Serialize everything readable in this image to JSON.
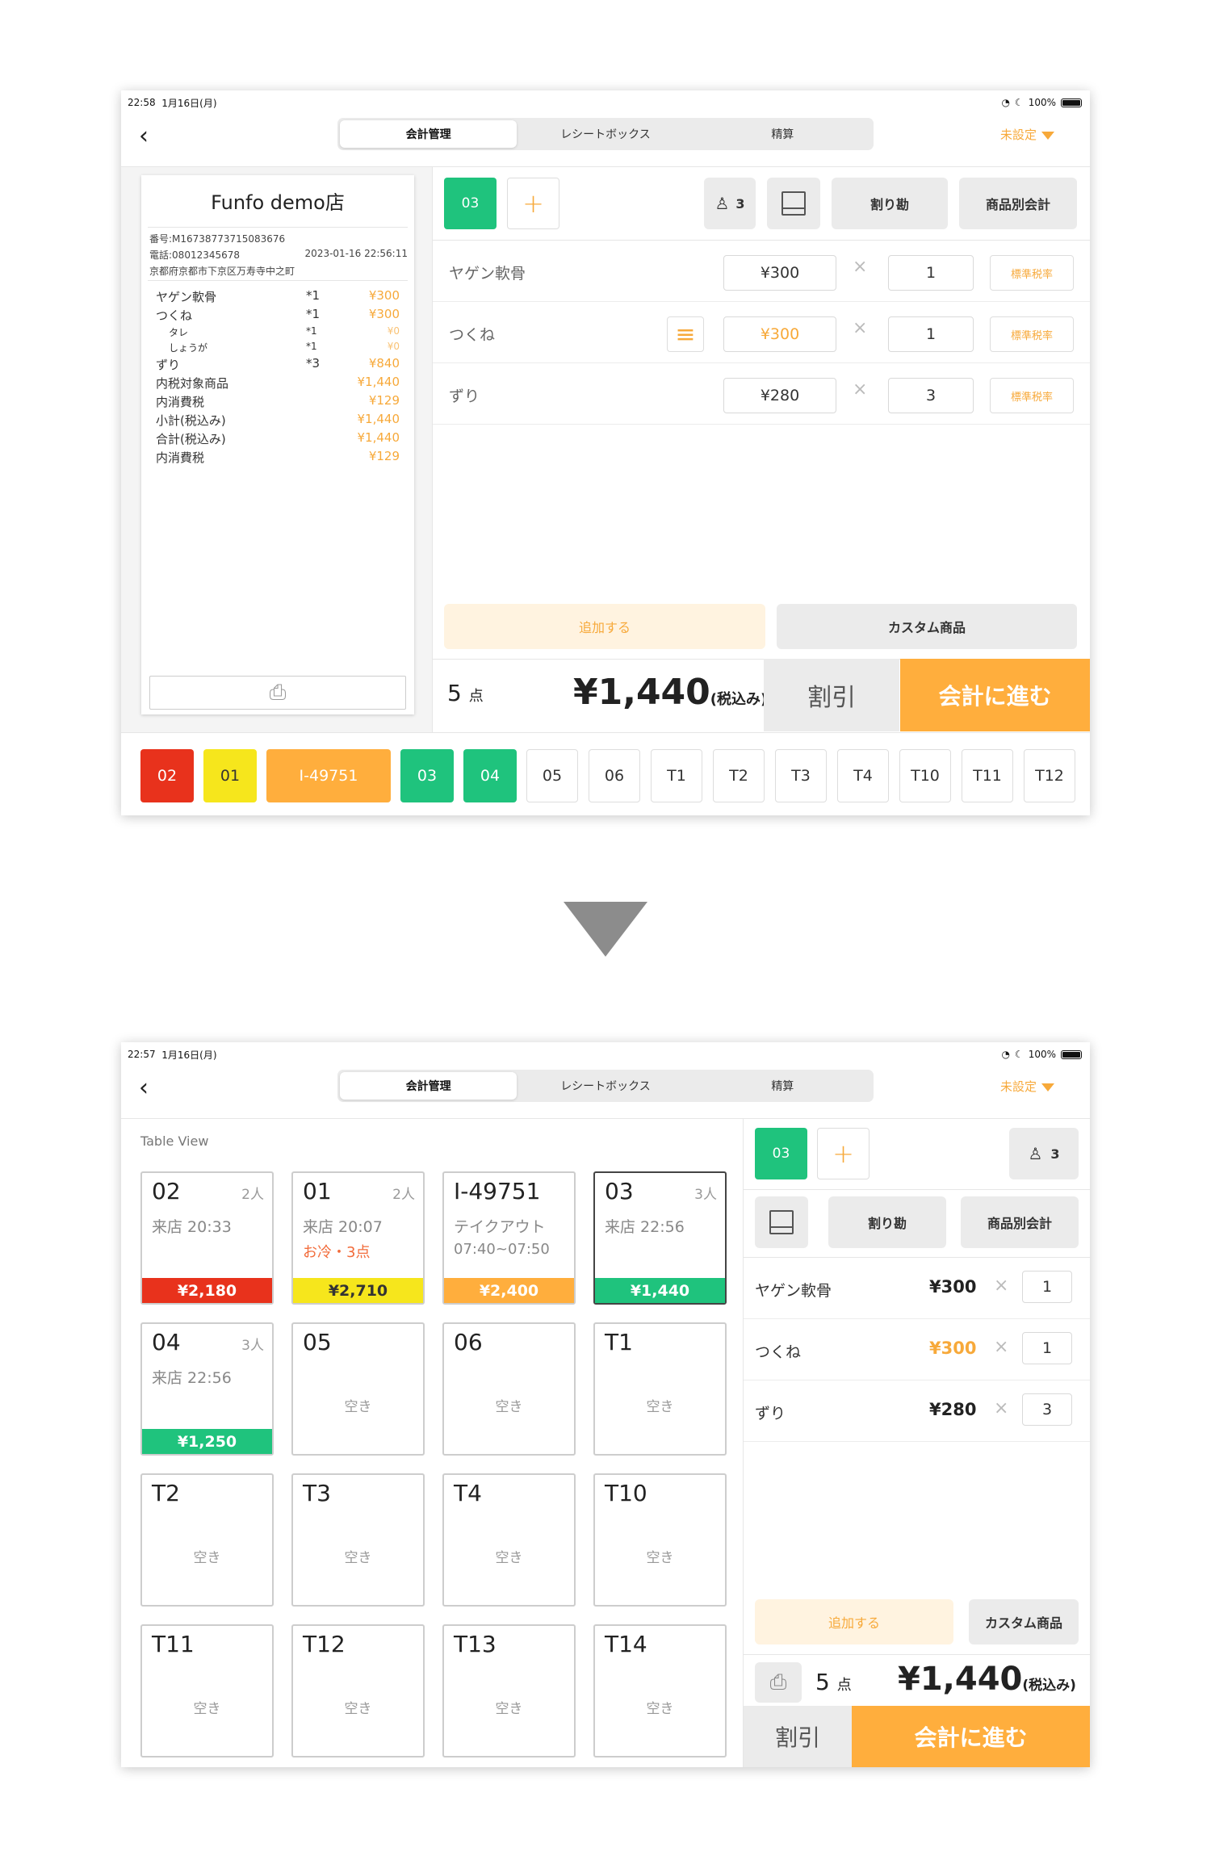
{
  "colors": {
    "accent": "#f7a93a",
    "green": "#1fc37d",
    "red": "#e8321c",
    "yellow": "#f6e61c",
    "orange": "#ffae3d"
  },
  "common": {
    "tabs": [
      "会計管理",
      "レシートボックス",
      "精算"
    ],
    "unset": "未設定",
    "date": "1月16日(月)",
    "battery": "100%",
    "order_tab": "03",
    "people": "3",
    "split_bill": "割り勘",
    "item_bill": "商品別会計",
    "add": "追加する",
    "custom": "カスタム商品",
    "count": "5",
    "count_unit": "点",
    "total": "¥1,440",
    "tax_incl": "(税込み)",
    "discount": "割引",
    "proceed": "会計に進む",
    "tax_label": "標準税率",
    "items": [
      {
        "name": "ヤゲン軟骨",
        "price": "¥300",
        "qty": "1"
      },
      {
        "name": "つくね",
        "price": "¥300",
        "qty": "1"
      },
      {
        "name": "ずり",
        "price": "¥280",
        "qty": "3"
      }
    ]
  },
  "screen1": {
    "time": "22:58",
    "receipt": {
      "store": "Funfo demo店",
      "number": "番号:M16738773715083676",
      "phone": "電話:08012345678",
      "datetime": "2023-01-16 22:56:11",
      "address": "京都府京都市下京区万寿寺中之町",
      "lines": [
        {
          "name": "ヤゲン軟骨",
          "qty": "*1",
          "val": "¥300",
          "sub": false
        },
        {
          "name": "つくね",
          "qty": "*1",
          "val": "¥300",
          "sub": false
        },
        {
          "name": "タレ",
          "qty": "*1",
          "val": "¥0",
          "sub": true
        },
        {
          "name": "しょうが",
          "qty": "*1",
          "val": "¥0",
          "sub": true
        },
        {
          "name": "ずり",
          "qty": "*3",
          "val": "¥840",
          "sub": false
        }
      ],
      "summary": [
        {
          "name": "内税対象商品",
          "val": "¥1,440"
        },
        {
          "name": "内消費税",
          "val": "¥129"
        },
        {
          "name": "小計(税込み)",
          "val": "¥1,440"
        },
        {
          "name": "合計(税込み)",
          "val": "¥1,440"
        },
        {
          "name": "内消費税",
          "val": "¥129"
        }
      ]
    },
    "tables": [
      "02",
      "01",
      "I-49751",
      "03",
      "04",
      "05",
      "06",
      "T1",
      "T2",
      "T3",
      "T4",
      "T10",
      "T11",
      "T12"
    ]
  },
  "screen2": {
    "time": "22:57",
    "view_title": "Table View",
    "cards": [
      {
        "name": "02",
        "people": "2人",
        "l1": "来店 20:33",
        "l2": "",
        "amount": "¥2,180",
        "color": "red"
      },
      {
        "name": "01",
        "people": "2人",
        "l1": "来店 20:07",
        "l2": "お冷・3点",
        "amount": "¥2,710",
        "color": "yellow"
      },
      {
        "name": "I-49751",
        "people": "",
        "l1": "テイクアウト",
        "l2": "07:40~07:50",
        "amount": "¥2,400",
        "color": "orange"
      },
      {
        "name": "03",
        "people": "3人",
        "l1": "来店 22:56",
        "l2": "",
        "amount": "¥1,440",
        "color": "green"
      },
      {
        "name": "04",
        "people": "3人",
        "l1": "来店 22:56",
        "l2": "",
        "amount": "¥1,250",
        "color": "green"
      },
      {
        "name": "05",
        "empty": "空き"
      },
      {
        "name": "06",
        "empty": "空き"
      },
      {
        "name": "T1",
        "empty": "空き"
      },
      {
        "name": "T2",
        "empty": "空き"
      },
      {
        "name": "T3",
        "empty": "空き"
      },
      {
        "name": "T4",
        "empty": "空き"
      },
      {
        "name": "T10",
        "empty": "空き"
      },
      {
        "name": "T11",
        "empty": "空き"
      },
      {
        "name": "T12",
        "empty": "空き"
      },
      {
        "name": "T13",
        "empty": "空き"
      },
      {
        "name": "T14",
        "empty": "空き"
      }
    ]
  }
}
